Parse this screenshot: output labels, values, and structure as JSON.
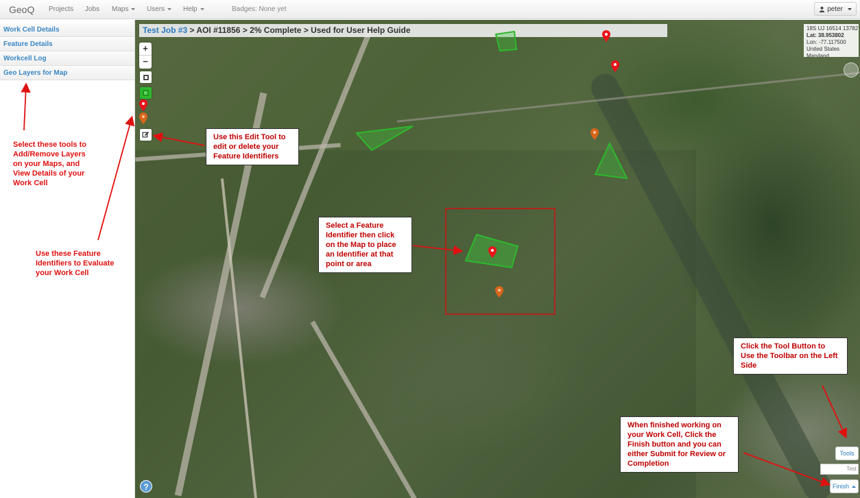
{
  "navbar": {
    "brand": "GeoQ",
    "items": [
      {
        "label": "Projects"
      },
      {
        "label": "Jobs"
      },
      {
        "label": "Maps"
      },
      {
        "label": "Users"
      },
      {
        "label": "Help"
      }
    ],
    "badges": "Badges: None yet",
    "user": "peter"
  },
  "sidebar": {
    "items": [
      {
        "label": "Work Cell Details"
      },
      {
        "label": "Feature Details"
      },
      {
        "label": "Workcell Log"
      },
      {
        "label": "Geo Layers for Map"
      }
    ]
  },
  "map": {
    "breadcrumb": {
      "job": "Test Job #3",
      "rest": " > AOI #11856 > 2% Complete > Used for User Help Guide"
    },
    "coords": {
      "grid": "18S UJ 16514 13782",
      "lat": "Lat: 38.953802",
      "lon": "Lon: -77.117500",
      "country": "United States",
      "state": "Maryland"
    },
    "zoom_in": "+",
    "zoom_out": "−",
    "help": "?",
    "tools_label": "Tools",
    "input_value": "Test",
    "finish_label": "Finish"
  },
  "annotations": {
    "edit_tool": "Use this Edit Tool to edit or delete your Feature Identifiers",
    "select_feature": "Select a Feature Identifier then click on the Map to place an Identifier at that point or area",
    "tool_button": "Click the Tool Button to Use the Toolbar on the Left Side",
    "finish": "When finished working on your Work Cell, Click the Finish button and you can either Submit for Review or Completion",
    "select_tools": "Select these tools to Add/Remove Layers on your Maps, and View Details of your Work Cell",
    "feature_identifiers": "Use these Feature Identifiers to Evaluate your Work Cell"
  },
  "colors": {
    "accent": "#2a7abf",
    "annotation_red": "#e01010",
    "feature_green": "#2db82d",
    "marker_red": "#e8141a",
    "marker_orange": "#d9661a"
  }
}
